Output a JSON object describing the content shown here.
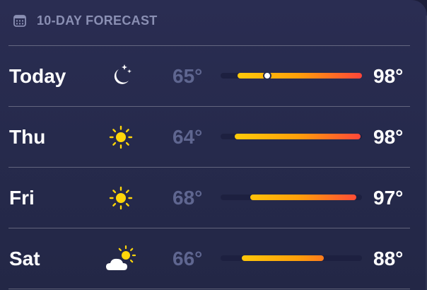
{
  "header": {
    "title": "10-DAY FORECAST",
    "icon": "calendar-icon"
  },
  "days": [
    {
      "day": "Today",
      "icon": "moon-stars-icon",
      "low": "65°",
      "high": "98°",
      "range_start": 0.12,
      "range_end": 1.0,
      "current": 0.33
    },
    {
      "day": "Thu",
      "icon": "sun-icon",
      "low": "64°",
      "high": "98°",
      "range_start": 0.1,
      "range_end": 0.99,
      "current": null
    },
    {
      "day": "Fri",
      "icon": "sun-icon",
      "low": "68°",
      "high": "97°",
      "range_start": 0.21,
      "range_end": 0.96,
      "current": null
    },
    {
      "day": "Sat",
      "icon": "partly-cloudy-icon",
      "low": "66°",
      "high": "88°",
      "range_start": 0.15,
      "range_end": 0.73,
      "current": null
    }
  ],
  "colors": {
    "sun": "#ffd60a",
    "bar_start": "#ffd60a",
    "bar_mid": "#ff9f0a",
    "bar_end": "#ff453a",
    "low_text": "#5f6690",
    "divider": "#4a4f78"
  }
}
